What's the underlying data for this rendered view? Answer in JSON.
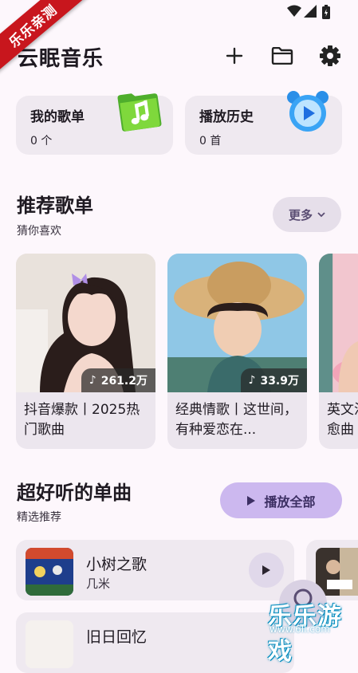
{
  "watermark_corner": "乐乐亲测",
  "header": {
    "title": "云眠音乐"
  },
  "library": [
    {
      "label": "我的歌单",
      "count": "0 个"
    },
    {
      "label": "播放历史",
      "count": "0 首"
    }
  ],
  "recommend": {
    "title": "推荐歌单",
    "subtitle": "猜你喜欢",
    "more_label": "更多",
    "playlists": [
      {
        "title": "抖音爆款丨2025热门歌曲",
        "plays": "261.2万"
      },
      {
        "title": "经典情歌丨这世间，有种爱恋在...",
        "plays": "33.9万"
      },
      {
        "title": "英文治愈曲",
        "plays": ""
      }
    ]
  },
  "singles": {
    "title": "超好听的单曲",
    "subtitle": "精选推荐",
    "play_all_label": "播放全部",
    "songs": [
      {
        "title": "小树之歌",
        "artist": "几米"
      },
      {
        "title": "旧日回忆",
        "artist": ""
      }
    ]
  },
  "watermark_bottom": {
    "text": "乐乐游戏",
    "url": "www.6ll.com"
  },
  "colors": {
    "accent": "#ccb8ef",
    "background": "#fdf7fc",
    "card": "#efe9f0"
  }
}
